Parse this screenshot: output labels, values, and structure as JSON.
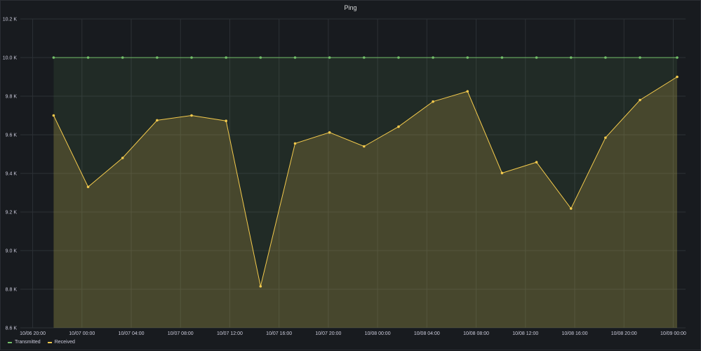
{
  "title": "Ping",
  "colors": {
    "transmitted": "#73bf69",
    "received": "#f2c94c",
    "grid": "#2c3035",
    "axis_text": "#ccccdc"
  },
  "legend": [
    {
      "name": "Transmitted",
      "color": "#73bf69"
    },
    {
      "name": "Received",
      "color": "#f2c94c"
    }
  ],
  "chart_data": {
    "type": "area",
    "title": "Ping",
    "y_ticks": [
      "8.6 K",
      "8.8 K",
      "9.0 K",
      "9.2 K",
      "9.4 K",
      "9.6 K",
      "9.8 K",
      "10.0 K",
      "10.2 K"
    ],
    "ylim": [
      8600,
      10200
    ],
    "x_ticks": [
      "10/06 20:00",
      "10/07 00:00",
      "10/07 04:00",
      "10/07 08:00",
      "10/07 12:00",
      "10/07 16:00",
      "10/07 20:00",
      "10/08 00:00",
      "10/08 04:00",
      "10/08 08:00",
      "10/08 12:00",
      "10/08 16:00",
      "10/08 20:00",
      "10/09 00:00"
    ],
    "x_tick_hours": [
      20,
      24,
      28,
      32,
      36,
      40,
      44,
      48,
      52,
      56,
      60,
      64,
      68,
      72
    ],
    "xlim_hours": [
      19,
      73
    ],
    "series": [
      {
        "name": "Transmitted",
        "color": "#73bf69",
        "x_hours": [
          21.7,
          24.5,
          27.3,
          30.1,
          32.9,
          35.7,
          38.5,
          41.3,
          44.1,
          46.9,
          49.7,
          52.5,
          55.3,
          58.1,
          60.9,
          63.7,
          66.5,
          69.3,
          74.6
        ],
        "values": [
          10000,
          10000,
          10000,
          10000,
          10000,
          10000,
          10000,
          10000,
          10000,
          10000,
          10000,
          10000,
          10000,
          10000,
          10000,
          10000,
          10000,
          10000,
          10000
        ]
      },
      {
        "name": "Received",
        "color": "#f2c94c",
        "x_hours": [
          21.7,
          24.5,
          27.3,
          30.1,
          32.9,
          35.7,
          38.5,
          41.3,
          44.1,
          46.9,
          49.7,
          52.5,
          55.3,
          58.1,
          60.9,
          63.7,
          66.5,
          69.3,
          74.6
        ],
        "values": [
          9700,
          9330,
          9480,
          9675,
          9700,
          9672,
          8815,
          9555,
          9612,
          9540,
          9642,
          9772,
          9825,
          9402,
          9458,
          9218,
          9585,
          9780,
          9900
        ]
      }
    ],
    "grid": true,
    "legend_position": "bottom-left"
  }
}
